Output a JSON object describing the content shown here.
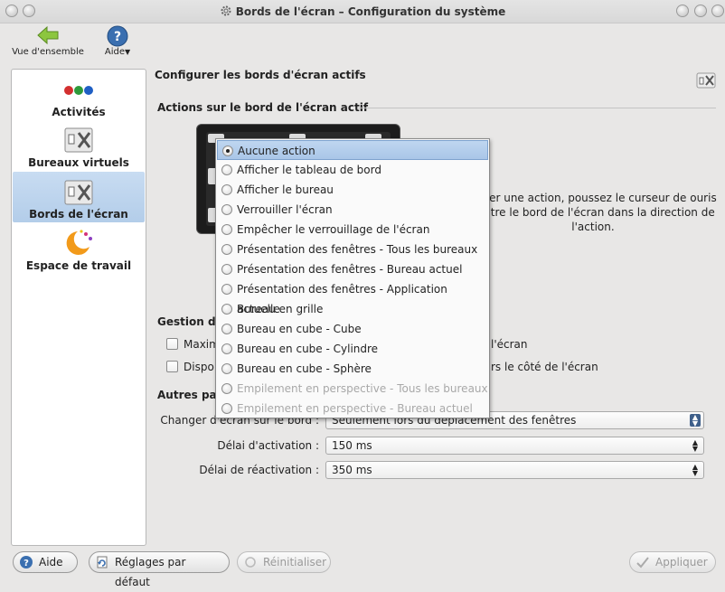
{
  "window": {
    "title": "Bords de l'écran – Configuration du système"
  },
  "toolbar": {
    "overview_label": "Vue d'ensemble",
    "help_label": "Aide"
  },
  "sidebar": {
    "items": [
      {
        "label": "Activités",
        "icon": "activities-icon",
        "selected": false
      },
      {
        "label": "Bureaux virtuels",
        "icon": "virtual-desktops-icon",
        "selected": false
      },
      {
        "label": "Bords de l'écran",
        "icon": "screen-edges-icon",
        "selected": true
      },
      {
        "label": "Espace de travail",
        "icon": "workspace-icon",
        "selected": false
      }
    ]
  },
  "main": {
    "heading": "Configurer les bords d'écran actifs",
    "section_actions": "Actions sur le bord de l'écran actif",
    "description": "Pour déclencher une action, poussez le curseur de votre souris contre le bord de l'écran dans la direction de l'action.",
    "description_visible": "ncher une action, poussez le curseur de ouris contre le bord de l'écran dans la direction de l'action.",
    "section_window": "Gestion de",
    "checkboxes": [
      {
        "label": "Maxim",
        "tail": "l'écran",
        "checked": false
      },
      {
        "label": "Dispo",
        "tail": "rs le côté de l'écran",
        "checked": false
      }
    ],
    "section_other": "Autres pa",
    "change_desktop": {
      "label": "Changer d'écran sur le bord :",
      "value": "Seulement lors du déplacement des fenêtres"
    },
    "activation_delay": {
      "label": "Délai d'activation :",
      "value": "150 ms"
    },
    "reactivation_delay": {
      "label": "Délai de réactivation :",
      "value": "350 ms"
    }
  },
  "popup": {
    "options": [
      {
        "label": "Aucune action",
        "selected": true,
        "disabled": false
      },
      {
        "label": "Afficher le tableau de bord",
        "selected": false,
        "disabled": false
      },
      {
        "label": "Afficher le bureau",
        "selected": false,
        "disabled": false
      },
      {
        "label": "Verrouiller l'écran",
        "selected": false,
        "disabled": false
      },
      {
        "label": "Empêcher le verrouillage de l'écran",
        "selected": false,
        "disabled": false
      },
      {
        "label": "Présentation des fenêtres - Tous les bureaux",
        "selected": false,
        "disabled": false
      },
      {
        "label": "Présentation des fenêtres - Bureau actuel",
        "selected": false,
        "disabled": false
      },
      {
        "label": "Présentation des fenêtres - Application actuelle",
        "selected": false,
        "disabled": false
      },
      {
        "label": "Bureau en grille",
        "selected": false,
        "disabled": false
      },
      {
        "label": "Bureau en cube - Cube",
        "selected": false,
        "disabled": false
      },
      {
        "label": "Bureau en cube - Cylindre",
        "selected": false,
        "disabled": false
      },
      {
        "label": "Bureau en cube - Sphère",
        "selected": false,
        "disabled": false
      },
      {
        "label": "Empilement en perspective - Tous les bureaux",
        "selected": false,
        "disabled": true
      },
      {
        "label": "Empilement en perspective - Bureau actuel",
        "selected": false,
        "disabled": true
      }
    ]
  },
  "footer": {
    "help": "Aide",
    "defaults": "Réglages par défaut",
    "reset": "Réinitialiser",
    "apply": "Appliquer"
  }
}
